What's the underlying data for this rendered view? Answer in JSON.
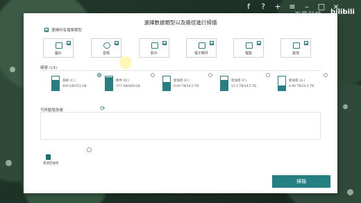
{
  "app": {
    "title": "選擇數據類型以及路徑進行掃描"
  },
  "toolbar_icons": [
    "facebook-icon",
    "help-icon",
    "plus-icon",
    "menu-icon",
    "minimize-icon",
    "maximize-icon",
    "close-icon"
  ],
  "watermark": {
    "text": "海風科技",
    "logo": "bilibili"
  },
  "select_all": {
    "label": "選擇所有檔案類型",
    "checked": true
  },
  "file_types": [
    {
      "label": "圖片",
      "icon": "image-icon",
      "checked": true
    },
    {
      "label": "音頻",
      "icon": "audio-icon",
      "checked": true
    },
    {
      "label": "影片",
      "icon": "video-icon",
      "checked": true
    },
    {
      "label": "電子郵件",
      "icon": "email-icon",
      "checked": true
    },
    {
      "label": "檔案",
      "icon": "document-icon",
      "checked": true
    },
    {
      "label": "其他",
      "icon": "folder-icon",
      "checked": true
    }
  ],
  "drives_header": "硬碟 (14)",
  "drives": [
    {
      "name": "系统 (C:)",
      "size": "400 GB/551 GB",
      "fill": 0.73,
      "selected": true
    },
    {
      "name": "軟件 (D:)",
      "size": "377 GB/400 GB",
      "fill": 0.94,
      "selected": false
    },
    {
      "name": "新加卷 (E:)",
      "size": "9.00 TB/14.5 TB",
      "fill": 0.62,
      "selected": false
    },
    {
      "name": "新加卷 (F:)",
      "size": "11.1 TB/14.5 TB",
      "fill": 0.77,
      "selected": false
    },
    {
      "name": "新加卷 (G:)",
      "size": "4.90 TB/14.5 TB",
      "fill": 0.34,
      "selected": false
    }
  ],
  "path_header": "可移動隨身碟",
  "recycle": {
    "label": "資源回收筒"
  },
  "scan_button": "掃描",
  "colors": {
    "accent": "#247f82"
  }
}
